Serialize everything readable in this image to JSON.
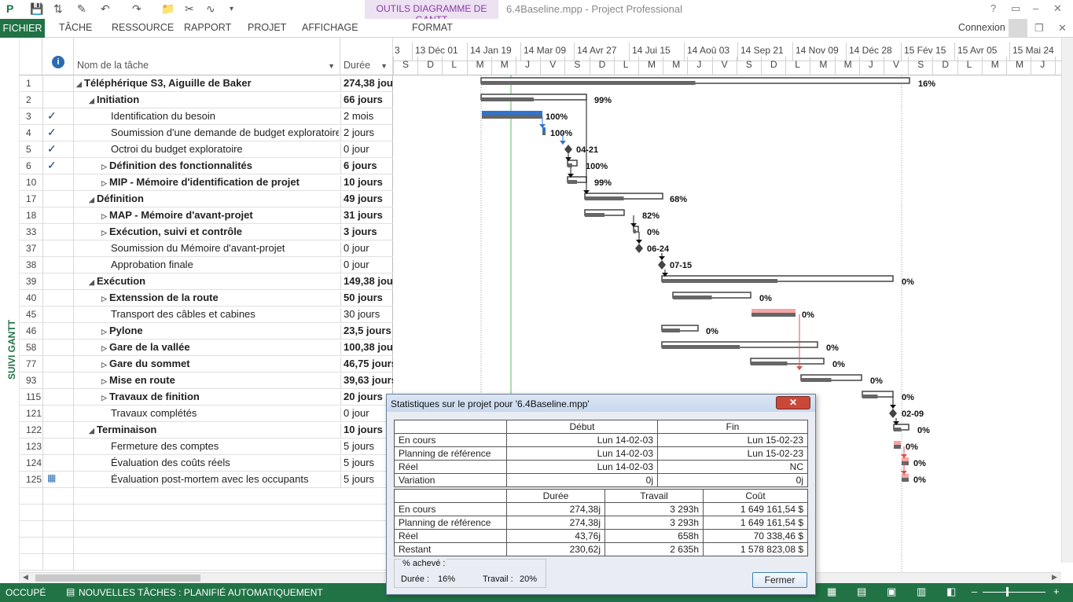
{
  "app": {
    "title": "6.4Baseline.mpp - Project Professional",
    "context_tab_title": "OUTILS DIAGRAMME DE GANTT",
    "connexion": "Connexion"
  },
  "ribbon": {
    "tabs": [
      "FICHIER",
      "TÂCHE",
      "RESSOURCE",
      "RAPPORT",
      "PROJET",
      "AFFICHAGE",
      "FORMAT"
    ]
  },
  "sidebar": {
    "label": "SUIVI GANTT"
  },
  "grid": {
    "headers": {
      "name": "Nom de la tâche",
      "duration": "Durée"
    },
    "rows": [
      {
        "id": "1",
        "name": "Téléphérique S3, Aiguille de Baker",
        "duration": "274,38 jours",
        "level": 0,
        "summary": true,
        "expanded": true,
        "done": false
      },
      {
        "id": "2",
        "name": "Initiation",
        "duration": "66 jours",
        "level": 1,
        "summary": true,
        "expanded": true,
        "done": false
      },
      {
        "id": "3",
        "name": "Identification du besoin",
        "duration": "2 mois",
        "level": 2,
        "summary": false,
        "done": true
      },
      {
        "id": "4",
        "name": "Soumission d'une demande de budget exploratoire",
        "duration": "2 jours",
        "level": 2,
        "summary": false,
        "done": true
      },
      {
        "id": "5",
        "name": "Octroi du budget exploratoire",
        "duration": "0 jour",
        "level": 2,
        "summary": false,
        "done": true
      },
      {
        "id": "6",
        "name": "Définition des fonctionnalités",
        "duration": "6 jours",
        "level": 2,
        "summary": true,
        "expanded": false,
        "done": true
      },
      {
        "id": "10",
        "name": "MIP - Mémoire d'identification de projet",
        "duration": "10 jours",
        "level": 2,
        "summary": true,
        "expanded": false,
        "done": false
      },
      {
        "id": "17",
        "name": "Définition",
        "duration": "49 jours",
        "level": 1,
        "summary": true,
        "expanded": true,
        "done": false
      },
      {
        "id": "18",
        "name": "MAP - Mémoire d'avant-projet",
        "duration": "31 jours",
        "level": 2,
        "summary": true,
        "expanded": false,
        "done": false
      },
      {
        "id": "33",
        "name": "Exécution, suivi et contrôle",
        "duration": "3 jours",
        "level": 2,
        "summary": true,
        "expanded": false,
        "done": false
      },
      {
        "id": "37",
        "name": "Soumission du Mémoire d'avant-projet",
        "duration": "0 jour",
        "level": 2,
        "summary": false,
        "done": false
      },
      {
        "id": "38",
        "name": "Approbation finale",
        "duration": "0 jour",
        "level": 2,
        "summary": false,
        "done": false
      },
      {
        "id": "39",
        "name": "Exécution",
        "duration": "149,38 jours",
        "level": 1,
        "summary": true,
        "expanded": true,
        "done": false
      },
      {
        "id": "40",
        "name": "Extenssion de la route",
        "duration": "50 jours",
        "level": 2,
        "summary": true,
        "expanded": false,
        "done": false
      },
      {
        "id": "45",
        "name": "Transport des câbles et cabines",
        "duration": "30 jours",
        "level": 2,
        "summary": false,
        "done": false
      },
      {
        "id": "46",
        "name": "Pylone",
        "duration": "23,5 jours",
        "level": 2,
        "summary": true,
        "expanded": false,
        "done": false
      },
      {
        "id": "58",
        "name": "Gare de la vallée",
        "duration": "100,38 jours",
        "level": 2,
        "summary": true,
        "expanded": false,
        "done": false
      },
      {
        "id": "77",
        "name": "Gare du sommet",
        "duration": "46,75 jours",
        "level": 2,
        "summary": true,
        "expanded": false,
        "done": false
      },
      {
        "id": "93",
        "name": "Mise en route",
        "duration": "39,63 jours",
        "level": 2,
        "summary": true,
        "expanded": false,
        "done": false
      },
      {
        "id": "115",
        "name": "Travaux de finition",
        "duration": "20 jours",
        "level": 2,
        "summary": true,
        "expanded": false,
        "done": false
      },
      {
        "id": "121",
        "name": "Travaux complétés",
        "duration": "0 jour",
        "level": 2,
        "summary": false,
        "done": false
      },
      {
        "id": "122",
        "name": "Terminaison",
        "duration": "10 jours",
        "level": 1,
        "summary": true,
        "expanded": true,
        "done": false
      },
      {
        "id": "123",
        "name": "Fermeture des comptes",
        "duration": "5 jours",
        "level": 2,
        "summary": false,
        "done": false
      },
      {
        "id": "124",
        "name": "Évaluation des coûts réels",
        "duration": "5 jours",
        "level": 2,
        "summary": false,
        "done": false
      },
      {
        "id": "125",
        "name": "Évaluation post-mortem avec les occupants",
        "duration": "5 jours",
        "level": 2,
        "summary": false,
        "done": false,
        "calendar": true
      }
    ]
  },
  "timescale": {
    "top": [
      "3",
      "13 Déc 01",
      "14 Jan 19",
      "14 Mar 09",
      "14 Avr 27",
      "14 Jui 15",
      "14 Aoû 03",
      "14 Sep 21",
      "14 Nov 09",
      "14 Déc 28",
      "15 Fév 15",
      "15 Avr 05",
      "15 Mai 24"
    ],
    "bottom": [
      "S",
      "D",
      "L",
      "M",
      "M",
      "J",
      "V",
      "S",
      "D",
      "L",
      "M",
      "M",
      "J",
      "V",
      "S",
      "D",
      "L",
      "M",
      "M",
      "J",
      "V",
      "S",
      "D",
      "L",
      "M",
      "M",
      "J",
      "V"
    ]
  },
  "bar_labels": [
    "16%",
    "99%",
    "100%",
    "100%",
    "04-21",
    "100%",
    "99%",
    "68%",
    "82%",
    "0%",
    "06-24",
    "07-15",
    "0%",
    "0%",
    "0%",
    "0%",
    "0%",
    "0%",
    "0%",
    "0%",
    "02-09",
    "0%",
    "0%",
    "0%",
    "0%"
  ],
  "dialog": {
    "title": "Statistiques sur le projet pour '6.4Baseline.mpp'",
    "close": "✕",
    "dates": {
      "headers": [
        "",
        "Début",
        "Fin"
      ],
      "rows": [
        [
          "En cours",
          "Lun 14-02-03",
          "Lun 15-02-23"
        ],
        [
          "Planning de référence",
          "Lun 14-02-03",
          "Lun 15-02-23"
        ],
        [
          "Réel",
          "Lun 14-02-03",
          "NC"
        ],
        [
          "Variation",
          "0j",
          "0j"
        ]
      ]
    },
    "totals": {
      "headers": [
        "",
        "Durée",
        "Travail",
        "Coût"
      ],
      "rows": [
        [
          "En cours",
          "274,38j",
          "3 293h",
          "1 649 161,54 $"
        ],
        [
          "Planning de référence",
          "274,38j",
          "3 293h",
          "1 649 161,54 $"
        ],
        [
          "Réel",
          "43,76j",
          "658h",
          "70 338,46 $"
        ],
        [
          "Restant",
          "230,62j",
          "2 635h",
          "1 578 823,08 $"
        ]
      ]
    },
    "pct_title": "% achevé :",
    "pct_duration_label": "Durée :",
    "pct_duration": "16%",
    "pct_work_label": "Travail :",
    "pct_work": "20%",
    "button": "Fermer"
  },
  "status": {
    "mode": "OCCUPÉ",
    "tasks": "NOUVELLES TÂCHES : PLANIFIÉ AUTOMATIQUEMENT"
  }
}
